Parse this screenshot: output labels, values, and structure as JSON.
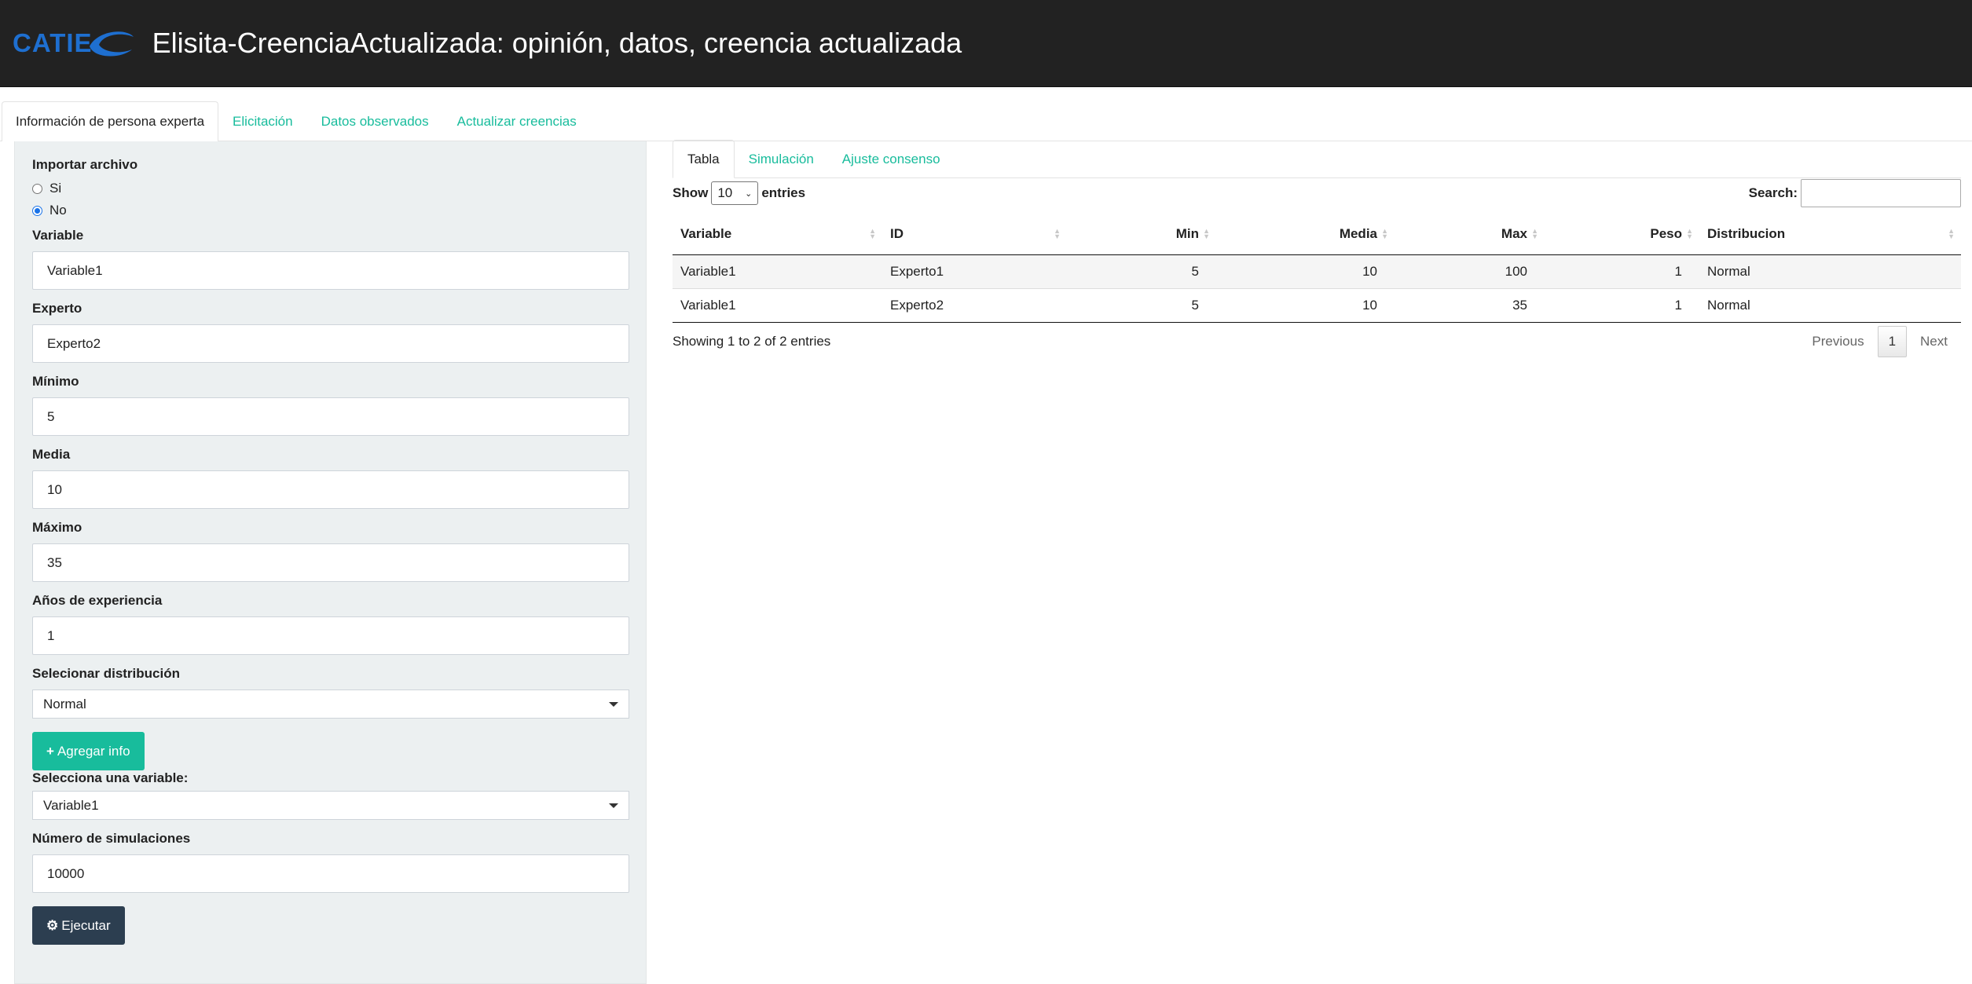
{
  "header": {
    "logo_text": "CATIE",
    "title": "Elisita-CreenciaActualizada: opinión, datos, creencia actualizada"
  },
  "main_tabs": [
    {
      "label": "Información de persona experta",
      "active": true
    },
    {
      "label": "Elicitación",
      "active": false
    },
    {
      "label": "Datos observados",
      "active": false
    },
    {
      "label": "Actualizar creencias",
      "active": false
    }
  ],
  "form": {
    "import_label": "Importar archivo",
    "import_options": [
      "Si",
      "No"
    ],
    "import_selected": "No",
    "variable_label": "Variable",
    "variable_value": "Variable1",
    "expert_label": "Experto",
    "expert_value": "Experto2",
    "min_label": "Mínimo",
    "min_value": "5",
    "mean_label": "Media",
    "mean_value": "10",
    "max_label": "Máximo",
    "max_value": "35",
    "years_label": "Años de experiencia",
    "years_value": "1",
    "dist_label": "Selecionar distribución",
    "dist_value": "Normal",
    "add_button": "Agregar info",
    "select_var_label": "Selecciona una variable:",
    "select_var_value": "Variable1",
    "sims_label": "Número de simulaciones",
    "sims_value": "10000",
    "run_button": "Ejecutar"
  },
  "sub_tabs": [
    {
      "label": "Tabla",
      "active": true
    },
    {
      "label": "Simulación",
      "active": false
    },
    {
      "label": "Ajuste consenso",
      "active": false
    }
  ],
  "datatable": {
    "show_label": "Show",
    "length_value": "10",
    "entries_label": "entries",
    "search_label": "Search:",
    "columns": [
      "Variable",
      "ID",
      "Min",
      "Media",
      "Max",
      "Peso",
      "Distribucion"
    ],
    "rows": [
      [
        "Variable1",
        "Experto1",
        "5",
        "10",
        "100",
        "1",
        "Normal"
      ],
      [
        "Variable1",
        "Experto2",
        "5",
        "10",
        "35",
        "1",
        "Normal"
      ]
    ],
    "info": "Showing 1 to 2 of 2 entries",
    "previous": "Previous",
    "page": "1",
    "next": "Next"
  },
  "colors": {
    "header_bg": "#222222",
    "accent": "#18bc9c",
    "primary": "#2c3e50",
    "sidebar_bg": "#ecf0f1",
    "logo": "#1e6fd0"
  }
}
